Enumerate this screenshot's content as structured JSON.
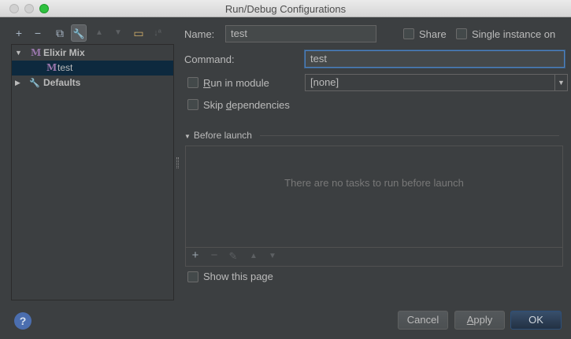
{
  "window": {
    "title": "Run/Debug Configurations"
  },
  "left_toolbar": {
    "icons": [
      "add-icon",
      "remove-icon",
      "copy-icon",
      "edit-defaults-icon",
      "move-up-icon",
      "move-down-icon",
      "folder-icon",
      "sort-icon"
    ],
    "add_glyph": "+",
    "remove_glyph": "−",
    "copy_glyph": "⧉",
    "wrench_glyph": "🔧",
    "up_glyph": "▲",
    "down_glyph": "▼",
    "folder_glyph": "▭",
    "sort_glyph": "↓ª"
  },
  "tree": {
    "items": [
      {
        "label": "Elixir Mix",
        "icon": "M",
        "expanded": true
      },
      {
        "label": "test",
        "icon": "M",
        "selected": true
      },
      {
        "label": "Defaults",
        "expanded": false
      }
    ]
  },
  "form": {
    "name_label": "Name:",
    "name_value": "test",
    "share_label": "Share",
    "single_instance_label": "Single instance on",
    "command_label": "Command:",
    "command_value": "test",
    "run_in_module_label_u": "R",
    "run_in_module_label_rest": "un in module",
    "run_in_module_value": "[none]",
    "skip_deps_label_pre": "Skip ",
    "skip_deps_label_u": "d",
    "skip_deps_label_rest": "ependencies"
  },
  "before_launch": {
    "title": "Before launch",
    "empty_text": "There are no tasks to run before launch",
    "show_this_page_label": "Show this page"
  },
  "buttons": {
    "cancel": "Cancel",
    "apply_u": "A",
    "apply_rest": "pply",
    "ok": "OK",
    "help": "?"
  }
}
